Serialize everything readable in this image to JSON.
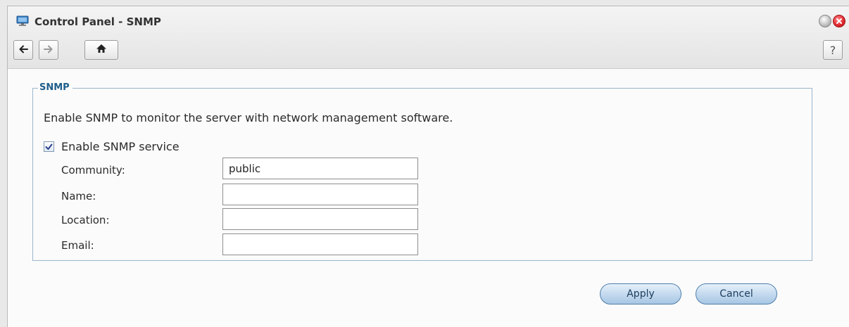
{
  "window": {
    "title": "Control Panel - SNMP",
    "icons": {
      "app": "control-panel-icon",
      "minimize": "minimize-icon",
      "close": "close-icon",
      "back": "arrow-left-icon",
      "forward": "arrow-right-icon",
      "home": "home-icon",
      "help": "help-icon"
    },
    "help_label": "?"
  },
  "snmp": {
    "legend": "SNMP",
    "description": "Enable SNMP to monitor the server with network management software.",
    "enable_label": "Enable SNMP service",
    "enable_checked": true,
    "fields": [
      {
        "label": "Community:",
        "value": "public"
      },
      {
        "label": "Name:",
        "value": ""
      },
      {
        "label": "Location:",
        "value": ""
      },
      {
        "label": "Email:",
        "value": ""
      }
    ]
  },
  "actions": {
    "apply": "Apply",
    "cancel": "Cancel"
  },
  "colors": {
    "accent": "#1f5d8a",
    "fieldset_border": "#9bb6cc",
    "button_border": "#4f7fab",
    "close": "#e0262e"
  }
}
